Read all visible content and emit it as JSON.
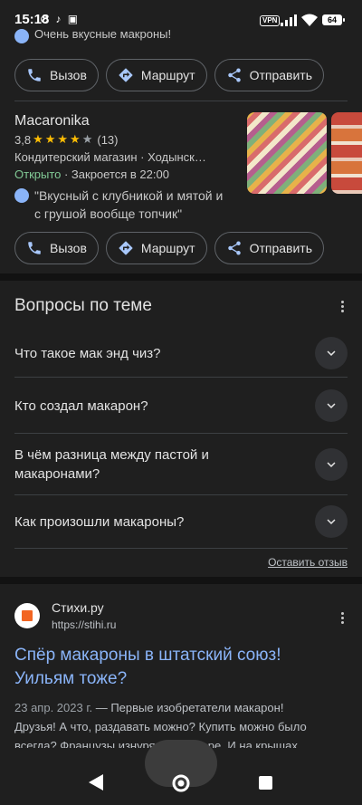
{
  "status": {
    "time": "15:18",
    "left_icons": "⊘ ♪ ▣",
    "vpn": "VPN",
    "battery": "64"
  },
  "top_card": {
    "review": "Очень вкусные макроны!",
    "actions": {
      "call": "Вызов",
      "route": "Маршрут",
      "share": "Отправить"
    }
  },
  "place": {
    "name": "Macaronika",
    "rating_value": "3,8",
    "stars_filled": 4,
    "rating_count": "(13)",
    "category_address": "Кондитерский магазин · Ходынск…",
    "open_status": "Открыто",
    "hours": " · Закроется в 22:00",
    "review_line1": "\"Вкусный с клубникой и мятой и",
    "review_line2": "с грушой вообще топчик\"",
    "actions": {
      "call": "Вызов",
      "route": "Маршрут",
      "share": "Отправить"
    }
  },
  "questions": {
    "title": "Вопросы по теме",
    "items": [
      "Что такое мак энд чиз?",
      "Кто создал макарон?",
      "В чём разница между пастой и макаронами?",
      "Как произошли макароны?"
    ],
    "feedback": "Оставить отзыв"
  },
  "result": {
    "site_name": "Стихи.ру",
    "site_url": "https://stihi.ru",
    "title_line1": "Спёр макароны в штатский союз!",
    "title_line2": "Уильям тоже?",
    "date": "23 апр. 2023 г.",
    "snippet_line1_rest": " — Первые изобретатели макарон!",
    "snippet_line2": "Друзья! А что, раздавать можно? Купить можно было",
    "snippet_line3": "всегда? Французы изнурялись в жаре. И на крышах…"
  },
  "icons": {
    "call": "phone-icon",
    "route": "directions-icon",
    "share": "share-icon",
    "expand": "chevron-down-icon",
    "more": "more-vert-icon",
    "back": "back-triangle-icon",
    "home": "home-circle-icon",
    "recents": "recents-square-icon"
  },
  "colors": {
    "background": "#1f1f1f",
    "accent_icon": "#a8c7fa",
    "link": "#8ab4f8",
    "open": "#81c995",
    "star": "#fbbc04"
  }
}
